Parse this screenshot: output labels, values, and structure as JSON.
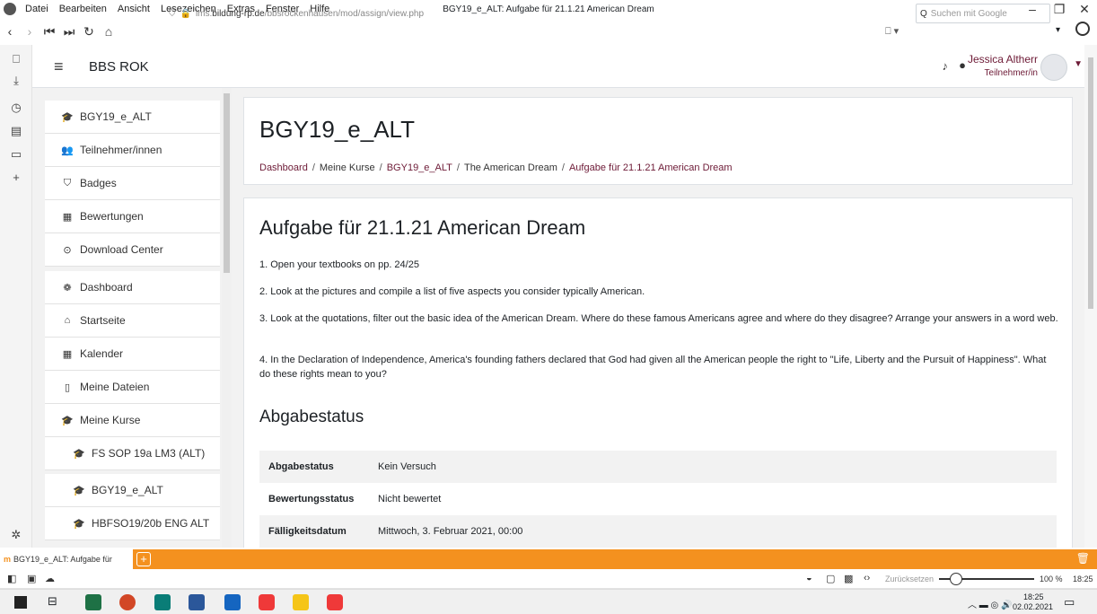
{
  "browser": {
    "menu": [
      "Datei",
      "Bearbeiten",
      "Ansicht",
      "Lesezeichen",
      "Extras",
      "Fenster",
      "Hilfe"
    ],
    "window_title": "BGY19_e_ALT: Aufgabe für 21.1.21 American Dream",
    "url_prefix": "lms.",
    "url_domain": "bildung-rp.de",
    "url_path": "/bbsrockenhausen/mod/assign/view.php",
    "search_placeholder": "Suchen mit Google"
  },
  "header": {
    "site_name": "BBS ROK",
    "user_name": "Jessica Altherr",
    "user_role": "Teilnehmer/in"
  },
  "drawer": {
    "items": [
      {
        "label": "BGY19_e_ALT",
        "icon": "graduation-cap-icon",
        "glyph": "🎓"
      },
      {
        "label": "Teilnehmer/innen",
        "icon": "users-icon",
        "glyph": "👥"
      },
      {
        "label": "Badges",
        "icon": "shield-icon",
        "glyph": "⛉"
      },
      {
        "label": "Bewertungen",
        "icon": "table-icon",
        "glyph": "▦"
      },
      {
        "label": "Download Center",
        "icon": "download-icon",
        "glyph": "⊙"
      },
      {
        "label": "Dashboard",
        "icon": "dashboard-icon",
        "glyph": "❁"
      },
      {
        "label": "Startseite",
        "icon": "home-icon",
        "glyph": "⌂"
      },
      {
        "label": "Kalender",
        "icon": "calendar-icon",
        "glyph": "▦"
      },
      {
        "label": "Meine Dateien",
        "icon": "file-icon",
        "glyph": "▯"
      },
      {
        "label": "Meine Kurse",
        "icon": "graduation-cap-icon",
        "glyph": "🎓"
      },
      {
        "label": "FS SOP 19a LM3 (ALT)",
        "icon": "graduation-cap-icon",
        "glyph": "🎓"
      },
      {
        "label": "BGY19_e_ALT",
        "icon": "graduation-cap-icon",
        "glyph": "🎓"
      },
      {
        "label": "HBFSO19/20b ENG ALT",
        "icon": "graduation-cap-icon",
        "glyph": "🎓"
      }
    ]
  },
  "course": {
    "title": "BGY19_e_ALT",
    "breadcrumb": [
      "Dashboard",
      "Meine Kurse",
      "BGY19_e_ALT",
      "The American Dream",
      "Aufgabe für 21.1.21 American Dream"
    ]
  },
  "assignment": {
    "title": "Aufgabe für 21.1.21 American Dream",
    "instructions": [
      "1. Open your textbooks on pp. 24/25",
      "2. Look at the pictures and compile a list of five aspects you consider typically American.",
      "3. Look at the quotations, filter out the basic idea of the American Dream. Where do these famous Americans agree and where do they disagree? Arrange your answers in a word web.",
      "4. In the Declaration of Independence, America's founding fathers declared that God had given all the American people the right to \"Life, Liberty and the Pursuit of Happiness\". What do these rights mean to you?"
    ],
    "status_heading": "Abgabestatus",
    "status_rows": [
      {
        "key": "Abgabestatus",
        "value": "Kein Versuch"
      },
      {
        "key": "Bewertungsstatus",
        "value": "Nicht bewertet"
      },
      {
        "key": "Fälligkeitsdatum",
        "value": "Mittwoch, 3. Februar 2021, 00:00"
      }
    ]
  },
  "tabs": {
    "active": "BGY19_e_ALT: Aufgabe für"
  },
  "status_bar": {
    "reset": "Zurücksetzen",
    "zoom": "100 %",
    "time": "18:25"
  },
  "taskbar": {
    "time": "18:25",
    "date": "02.02.2021"
  },
  "colors": {
    "accent": "#6d1a36",
    "tabbar": "#f4911f"
  }
}
